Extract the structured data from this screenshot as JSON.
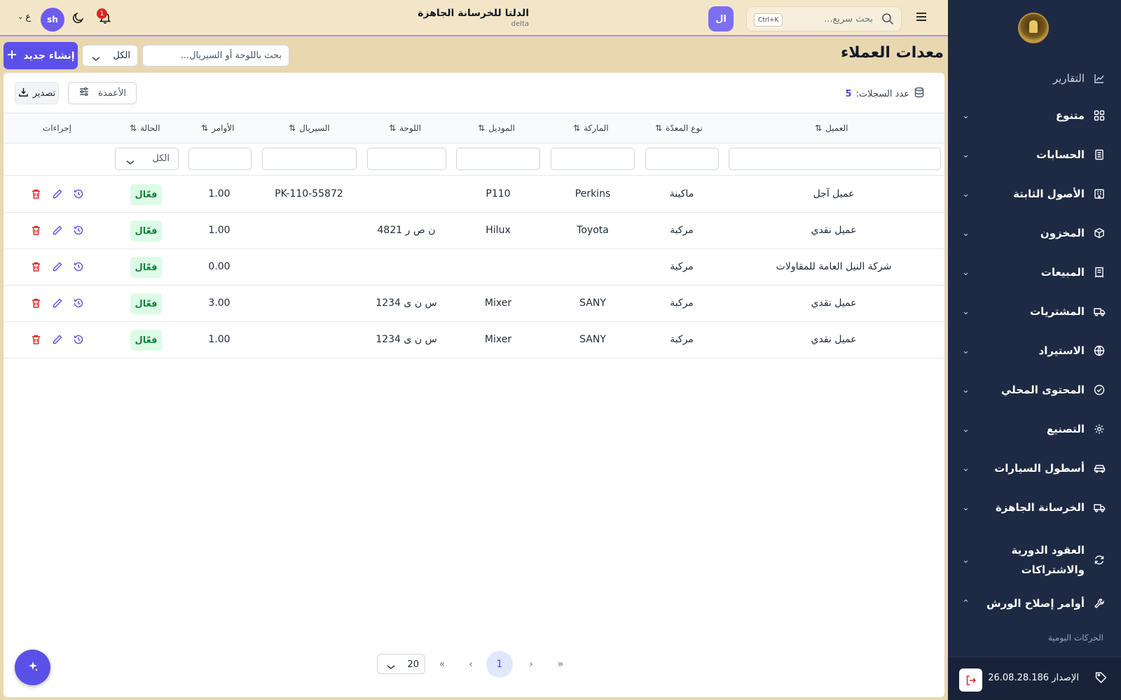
{
  "colors": {
    "accent": "#5b50e8",
    "sidebar_bg": "#1e2a44",
    "status_active_bg": "#dcfce7",
    "status_active_text": "#15803d",
    "delete_red": "#dc2626"
  },
  "topbar": {
    "search_placeholder": "بحث سريع...",
    "shortcut": "Ctrl+K",
    "company_initials": "ال",
    "company_name": "الدلتا للخرسانة الجاهزة",
    "company_code": "delta",
    "notifications_count": "1",
    "user_initials": "sh",
    "language": "ع"
  },
  "page": {
    "title": "معدات العملاء",
    "create_label": "إنشاء جديد",
    "status_filter_value": "الكل",
    "search_placeholder": "بحث باللوحة أو السيريال..."
  },
  "toolbar": {
    "records_label": "عدد السجلات:",
    "records_count": "5",
    "columns_label": "الأعمدة",
    "export_label": "تصدير"
  },
  "table": {
    "headers": {
      "customer": "العميل",
      "type": "نوع المعدّة",
      "brand": "الماركة",
      "model": "الموديل",
      "plate": "اللوحة",
      "serial": "السيريال",
      "orders": "الأوامر",
      "status": "الحالة",
      "actions": "إجراءات"
    },
    "status_filter": "الكل",
    "rows": [
      {
        "customer": "عميل آجل",
        "type": "ماكينة",
        "brand": "Perkins",
        "model": "P110",
        "plate": "",
        "serial": "PK-110-55872",
        "orders": "1.00",
        "status": "فعّال"
      },
      {
        "customer": "عميل نقدي",
        "type": "مركبة",
        "brand": "Toyota",
        "model": "Hilux",
        "plate": "ن ص ر 4821",
        "serial": "",
        "orders": "1.00",
        "status": "فعّال"
      },
      {
        "customer": "شركة النيل العامة للمقاولات",
        "type": "مركبة",
        "brand": "",
        "model": "",
        "plate": "",
        "serial": "",
        "orders": "0.00",
        "status": "فعّال"
      },
      {
        "customer": "عميل نقدي",
        "type": "مركبة",
        "brand": "SANY",
        "model": "Mixer",
        "plate": "س ن ى 1234",
        "serial": "",
        "orders": "3.00",
        "status": "فعّال"
      },
      {
        "customer": "عميل نقدي",
        "type": "مركبة",
        "brand": "SANY",
        "model": "Mixer",
        "plate": "س ن ى 1234",
        "serial": "",
        "orders": "1.00",
        "status": "فعّال"
      }
    ]
  },
  "pagination": {
    "page_size": "20",
    "current_page": "1"
  },
  "sidebar": {
    "items": [
      {
        "label": "التقارير",
        "icon": "chart-icon"
      },
      {
        "label": "متنوع",
        "icon": "grid-icon"
      },
      {
        "label": "الحسابات",
        "icon": "ledger-icon"
      },
      {
        "label": "الأصول الثابتة",
        "icon": "building-icon"
      },
      {
        "label": "المخزون",
        "icon": "box-icon"
      },
      {
        "label": "المبيعات",
        "icon": "receipt-icon"
      },
      {
        "label": "المشتريات",
        "icon": "truck-icon"
      },
      {
        "label": "الاستيراد",
        "icon": "globe-icon"
      },
      {
        "label": "المحتوى المحلي",
        "icon": "check-circle-icon"
      },
      {
        "label": "التصنيع",
        "icon": "gear-icon"
      },
      {
        "label": "أسطول السيارات",
        "icon": "car-icon"
      },
      {
        "label": "الخرسانة الجاهزة",
        "icon": "mixer-truck-icon"
      },
      {
        "label": "العقود الدورية والاشتراكات",
        "icon": "refresh-icon"
      },
      {
        "label": "أوامر إصلاح الورش",
        "icon": "wrench-icon"
      }
    ],
    "sub_item": "الحركات اليومية",
    "version": "الإصدار 26.08.28.186"
  }
}
